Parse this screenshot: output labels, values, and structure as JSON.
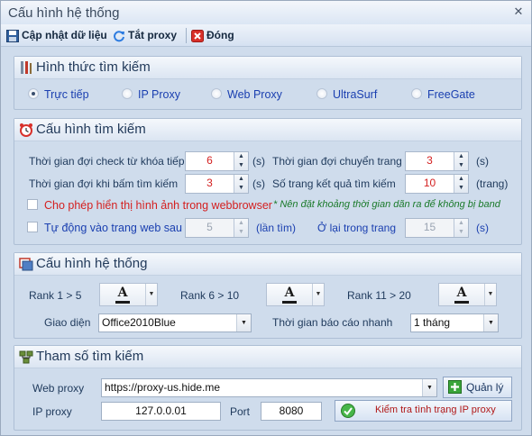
{
  "window": {
    "title": "Cấu hình hệ thống",
    "close_glyph": "✕"
  },
  "toolbar": {
    "update_label": "Cập nhật dữ liệu",
    "proxy_off_label": "Tắt proxy",
    "close_label": "Đóng"
  },
  "search_mode": {
    "title": "Hình thức tìm kiếm",
    "options": [
      {
        "label": "Trực tiếp",
        "selected": true,
        "color": "#d42020"
      },
      {
        "label": "IP Proxy",
        "selected": false
      },
      {
        "label": "Web Proxy",
        "selected": false
      },
      {
        "label": "UltraSurf",
        "selected": false
      },
      {
        "label": "FreeGate",
        "selected": false
      }
    ]
  },
  "search_config": {
    "title": "Cấu hình tìm kiếm",
    "wait_check_keyword_label": "Thời gian đợi check từ khóa tiếp",
    "wait_check_keyword_value": "6",
    "wait_check_keyword_unit": "(s)",
    "wait_page_switch_label": "Thời gian đợi chuyển trang",
    "wait_page_switch_value": "3",
    "wait_page_switch_unit": "(s)",
    "wait_click_search_label": "Thời gian đợi khi bấm tìm kiếm",
    "wait_click_search_value": "3",
    "wait_click_search_unit": "(s)",
    "result_pages_label": "Số trang kết quả tìm kiếm",
    "result_pages_value": "10",
    "result_pages_unit": "(trang)",
    "show_images_label": "Cho phép hiển thị hình ảnh trong webbrowser",
    "show_images_checked": false,
    "note": "* Nên đặt khoảng thời gian dãn ra để không bị band",
    "auto_visit_label": "Tự động vào trang web sau",
    "auto_visit_checked": false,
    "auto_visit_value": "5",
    "auto_visit_unit": "(lần tìm)",
    "stay_label": "Ở lại trong trang",
    "stay_value": "15",
    "stay_unit": "(s)"
  },
  "system_config": {
    "title": "Cấu hình hệ thống",
    "rank1_label": "Rank 1 > 5",
    "rank2_label": "Rank 6 > 10",
    "rank3_label": "Rank 11 > 20",
    "font_glyph": "A",
    "interface_label": "Giao diện",
    "interface_value": "Office2010Blue",
    "report_time_label": "Thời gian báo cáo nhanh",
    "report_time_value": "1 tháng"
  },
  "search_params": {
    "title": "Tham số tìm kiếm",
    "web_proxy_label": "Web proxy",
    "web_proxy_value": "https://proxy-us.hide.me",
    "manage_label": "Quản lý",
    "ip_proxy_label": "IP proxy",
    "ip_proxy_value": "127.0.0.01",
    "port_label": "Port",
    "port_value": "8080",
    "check_label": "Kiểm tra tình trạng IP proxy"
  }
}
